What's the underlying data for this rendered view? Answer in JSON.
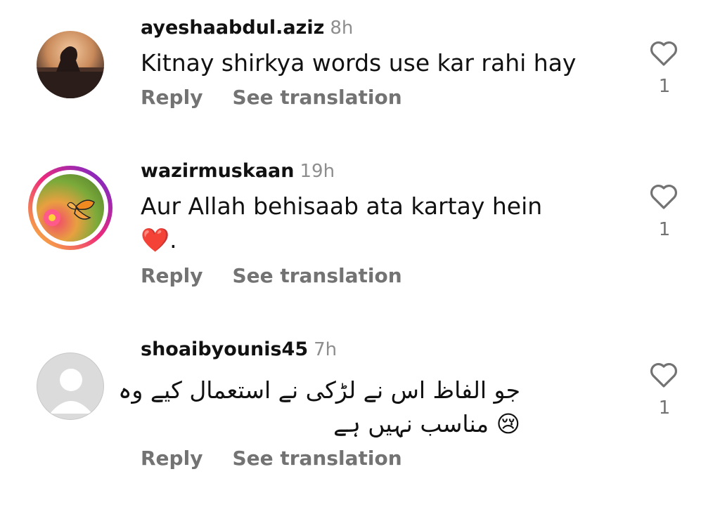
{
  "comments": [
    {
      "username": "ayeshaabdul.aziz",
      "time": "8h",
      "text_lines": [
        "Kitnay shirkya words use kar rahi hay"
      ],
      "reply_label": "Reply",
      "translate_label": "See translation",
      "like_count": "1",
      "avatar": "sunset-silhouette-avatar"
    },
    {
      "username": "wazirmuskaan",
      "time": "19h",
      "text_lines": [
        "Aur Allah behisaab ata kartay hein",
        "❤️."
      ],
      "reply_label": "Reply",
      "translate_label": "See translation",
      "like_count": "1",
      "avatar": "butterfly-flower-avatar"
    },
    {
      "username": "shoaibyounis45",
      "time": "7h",
      "text_lines": [
        "جو الفاظ اس نے لڑکی نے استعمال کیے وہ",
        "😢 مناسب نہیں ہے"
      ],
      "reply_label": "Reply",
      "translate_label": "See translation",
      "like_count": "1",
      "avatar": "default-user-avatar"
    }
  ],
  "colors": {
    "text": "#111111",
    "muted": "#737373",
    "time": "#8e8e8e",
    "story_ring_start": "#f9ce34",
    "story_ring_mid": "#ee2a7b",
    "story_ring_end": "#6228d7"
  }
}
